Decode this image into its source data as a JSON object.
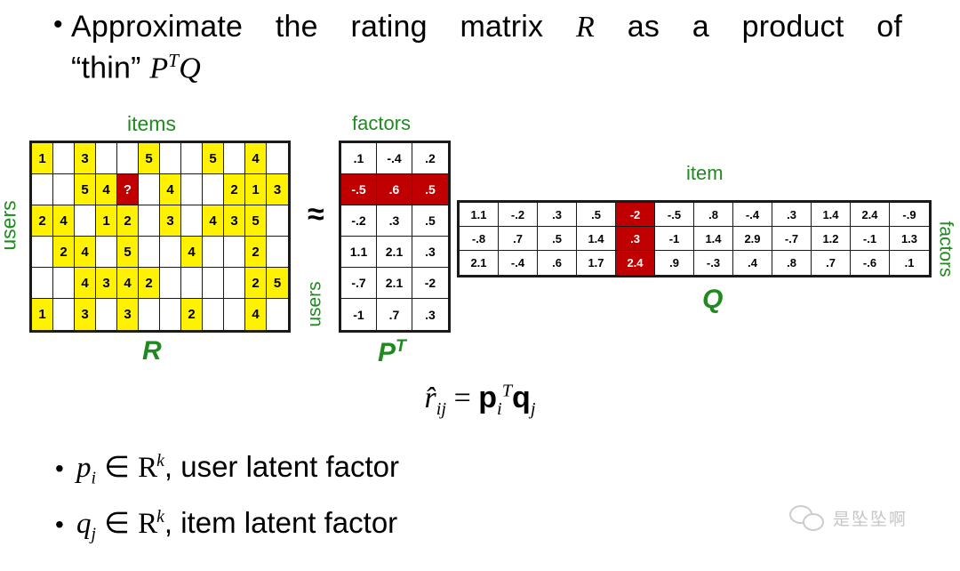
{
  "slide": {
    "bullet_top": {
      "marker": "•",
      "line1_pre": "Approximate the rating matrix ",
      "line1_var": "R",
      "line1_post": " as a product of",
      "line2_pre": "“thin” ",
      "line2_P": "P",
      "line2_T": "T",
      "line2_Q": "Q"
    },
    "bullet_p": {
      "marker": "•",
      "var": "p",
      "sub": "i",
      "in": " ∈ ",
      "field": "R",
      "field_sup": "k",
      "text": ", user latent factor"
    },
    "bullet_q": {
      "marker": "•",
      "var": "q",
      "sub": "j",
      "in": " ∈ ",
      "field": "R",
      "field_sup": "k",
      "text": ", item latent factor"
    },
    "formula": {
      "lhs_var": "r̂",
      "lhs_sub": "ij",
      "eq": " = ",
      "p": "p",
      "p_sub": "i",
      "p_sup": "T",
      "q": "q",
      "q_sub": "j"
    },
    "approx_sign": "≈"
  },
  "labels": {
    "items": "items",
    "users_left": "users",
    "users_pt": "users",
    "factors_top": "factors",
    "factors_right": "factors",
    "item": "item",
    "R": "R",
    "P": "P",
    "P_sup": "T",
    "Q": "Q"
  },
  "colors": {
    "highlight_yellow": "#FFF200",
    "highlight_red": "#C00000",
    "label_green": "#1F8A1F",
    "grid_black": "#1A1A1A",
    "watermark_gray": "#8D8D8D"
  },
  "matrices": {
    "R": {
      "rows": 6,
      "cols": 12,
      "missing_marker": "?",
      "cells": [
        [
          "1",
          "",
          "3",
          "",
          "",
          "5",
          "",
          "",
          "5",
          "",
          "4",
          ""
        ],
        [
          "",
          "",
          "5",
          "4",
          "?",
          "",
          "4",
          "",
          "",
          "2",
          "1",
          "3"
        ],
        [
          "2",
          "4",
          "",
          "1",
          "2",
          "",
          "3",
          "",
          "4",
          "3",
          "5",
          ""
        ],
        [
          "",
          "2",
          "4",
          "",
          "5",
          "",
          "",
          "4",
          "",
          "",
          "2",
          ""
        ],
        [
          "",
          "",
          "4",
          "3",
          "4",
          "2",
          "",
          "",
          "",
          "",
          "2",
          "5"
        ],
        [
          "1",
          "",
          "3",
          "",
          "3",
          "",
          "",
          "2",
          "",
          "",
          "4",
          ""
        ]
      ],
      "red_cell": [
        1,
        4
      ]
    },
    "PT": {
      "rows": 6,
      "cols": 3,
      "cells": [
        [
          ".1",
          "-.4",
          ".2"
        ],
        [
          "-.5",
          ".6",
          ".5"
        ],
        [
          "-.2",
          ".3",
          ".5"
        ],
        [
          "1.1",
          "2.1",
          ".3"
        ],
        [
          "-.7",
          "2.1",
          "-2"
        ],
        [
          "-1",
          ".7",
          ".3"
        ]
      ],
      "red_row": 1
    },
    "Q": {
      "rows": 3,
      "cols": 12,
      "cells": [
        [
          "1.1",
          "-.2",
          ".3",
          ".5",
          "-2",
          "-.5",
          ".8",
          "-.4",
          ".3",
          "1.4",
          "2.4",
          "-.9"
        ],
        [
          "-.8",
          ".7",
          ".5",
          "1.4",
          ".3",
          "-1",
          "1.4",
          "2.9",
          "-.7",
          "1.2",
          "-.1",
          "1.3"
        ],
        [
          "2.1",
          "-.4",
          ".6",
          "1.7",
          "2.4",
          ".9",
          "-.3",
          ".4",
          ".8",
          ".7",
          "-.6",
          ".1"
        ]
      ],
      "red_col": 4
    }
  },
  "watermark": {
    "icon": "wechat-icon",
    "text": "是坠坠啊"
  }
}
